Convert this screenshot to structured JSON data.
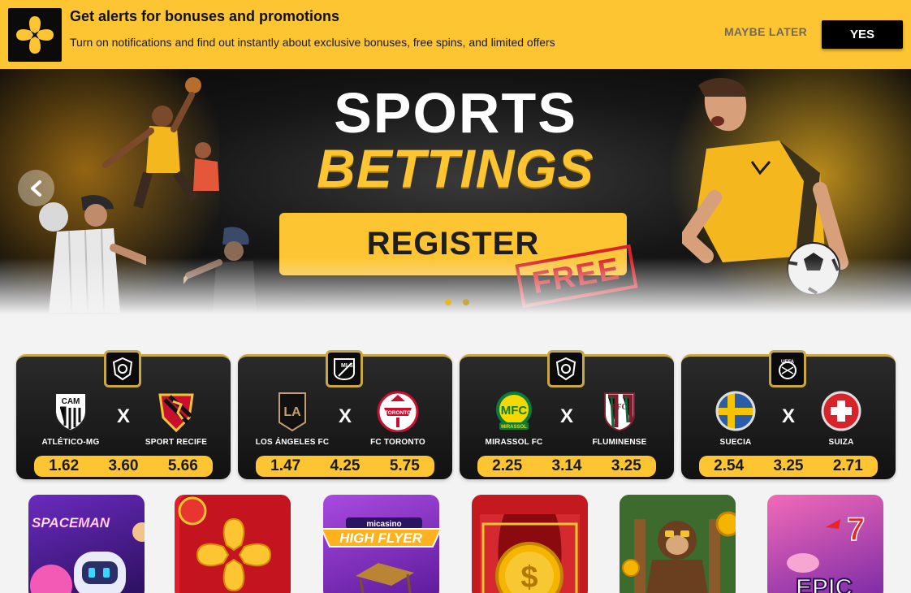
{
  "notification": {
    "title": "Get alerts for bonuses and promotions",
    "body": "Turn on notifications and find out instantly about exclusive bonuses, free spins, and limited offers",
    "maybe_later": "MAYBE LATER",
    "yes": "YES"
  },
  "hero": {
    "line1": "SPORTS",
    "line2": "BETTINGS",
    "cta": "REGISTER",
    "stamp": "FREE",
    "slide_count": 2,
    "active_slide": 1
  },
  "matches": [
    {
      "league_icon": "brasileirao-icon",
      "home": "ATLÉTICO-MG",
      "away": "SPORT RECIFE",
      "odds": [
        "1.62",
        "3.60",
        "5.66"
      ]
    },
    {
      "league_icon": "mls-icon",
      "league_label": "MLS",
      "home": "LOS ÁNGELES FC",
      "away": "FC TORONTO",
      "odds": [
        "1.47",
        "4.25",
        "5.75"
      ]
    },
    {
      "league_icon": "brasileirao-icon",
      "home": "MIRASSOL FC",
      "away": "FLUMINENSE",
      "odds": [
        "2.25",
        "3.14",
        "3.25"
      ]
    },
    {
      "league_icon": "uefa-icon",
      "league_label": "UEFA",
      "home": "SUECIA",
      "away": "SUIZA",
      "odds": [
        "2.54",
        "3.25",
        "2.71"
      ]
    }
  ],
  "vs_label": "X",
  "team_badges": {
    "atletico": "CAM",
    "lafc": "LA",
    "toronto": "TORONTO",
    "mirassol": "MFC",
    "mirassol_sub": "MIRASSOL"
  },
  "games": [
    {
      "label": "SPACEMAN"
    },
    {
      "label": ""
    },
    {
      "label": "HIGH FLYER",
      "brand": "micasino"
    },
    {
      "label": ""
    },
    {
      "label": ""
    },
    {
      "label": "EPIC"
    }
  ],
  "colors": {
    "brand_yellow": "#fdc532",
    "dark": "#111111",
    "stamp_red": "#d9232a",
    "gold_border": "#c9a742"
  }
}
